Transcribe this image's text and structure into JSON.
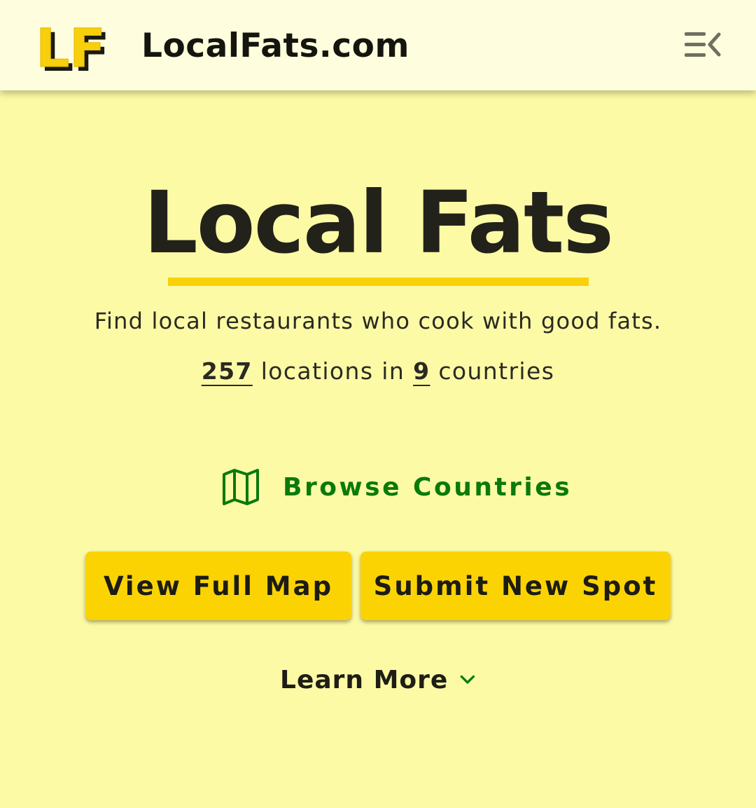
{
  "header": {
    "logo_text": "LF",
    "site_name": "LocalFats.com",
    "menu_icon": "menu-collapse-icon"
  },
  "hero": {
    "title": "Local Fats",
    "tagline": "Find local restaurants who cook with good fats."
  },
  "stats": {
    "locations_count": "257",
    "locations_label": "locations in",
    "countries_count": "9",
    "countries_label": "countries"
  },
  "browse": {
    "icon": "map-icon",
    "label": "Browse Countries"
  },
  "buttons": {
    "view_map": "View Full Map",
    "submit_spot": "Submit New Spot"
  },
  "learn_more": {
    "label": "Learn More",
    "icon": "chevron-down-icon"
  },
  "colors": {
    "page_background": "#fdfaa6",
    "header_background": "#fefddd",
    "accent_yellow": "#fbd303",
    "link_green": "#0a7a0a",
    "text_dark": "#22221a"
  }
}
